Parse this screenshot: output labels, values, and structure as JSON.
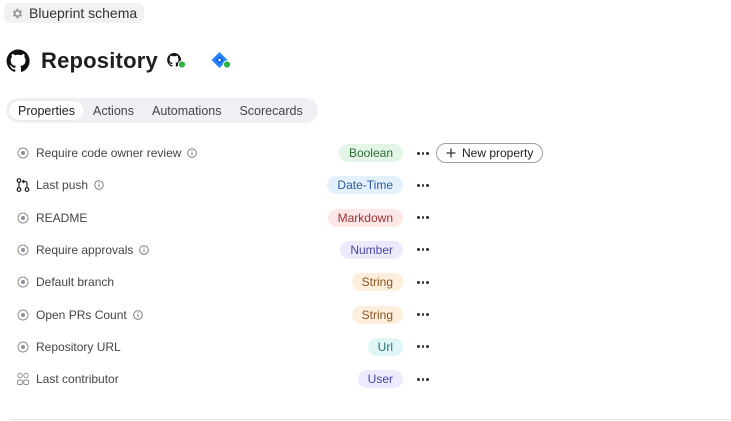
{
  "breadcrumb": {
    "icon": "gear-icon",
    "label": "Blueprint schema"
  },
  "header": {
    "logo": "github-icon",
    "title": "Repository",
    "integrations": [
      {
        "name": "github-integration-icon",
        "status_color": "#2fb344"
      },
      {
        "name": "jira-integration-icon",
        "status_color": "#2fb344"
      }
    ]
  },
  "tabs": [
    {
      "label": "Properties",
      "active": true
    },
    {
      "label": "Actions",
      "active": false
    },
    {
      "label": "Automations",
      "active": false
    },
    {
      "label": "Scorecards",
      "active": false
    }
  ],
  "properties": [
    {
      "label": "Require code owner review",
      "icon": "circle-dot-icon",
      "info": true,
      "type": "Boolean",
      "bg": "#e3f5e6",
      "fg": "#2c6e36"
    },
    {
      "label": "Last push",
      "icon": "git-pull-request-icon",
      "info": true,
      "type": "Date-Time",
      "bg": "#e4f0fc",
      "fg": "#2b5d9b"
    },
    {
      "label": "README",
      "icon": "circle-dot-icon",
      "info": false,
      "type": "Markdown",
      "bg": "#fde7e7",
      "fg": "#9b3232"
    },
    {
      "label": "Require approvals",
      "icon": "circle-dot-icon",
      "info": true,
      "type": "Number",
      "bg": "#ecebfd",
      "fg": "#4a46a8"
    },
    {
      "label": "Default branch",
      "icon": "circle-dot-icon",
      "info": false,
      "type": "String",
      "bg": "#fdeedd",
      "fg": "#8a5420"
    },
    {
      "label": "Open PRs Count",
      "icon": "circle-dot-icon",
      "info": true,
      "type": "String",
      "bg": "#fdeedd",
      "fg": "#8a5420"
    },
    {
      "label": "Repository URL",
      "icon": "circle-dot-icon",
      "info": false,
      "type": "Url",
      "bg": "#e0f6f6",
      "fg": "#2a7474"
    },
    {
      "label": "Last contributor",
      "icon": "users-icon",
      "info": false,
      "type": "User",
      "bg": "#ecebfd",
      "fg": "#4a46a8"
    }
  ],
  "actions": {
    "new_property_label": "New property",
    "new_property_icon": "plus-icon",
    "row_menu_icon": "more-dots-icon"
  }
}
